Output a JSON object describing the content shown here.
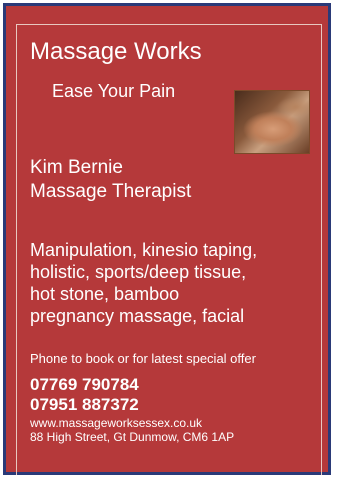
{
  "business": {
    "name": "Massage Works",
    "tagline": "Ease Your Pain"
  },
  "therapist": {
    "name": "Kim Bernie",
    "role": "Massage Therapist"
  },
  "services": {
    "lines": [
      "Manipulation, kinesio taping,",
      "holistic, sports/deep tissue,",
      "hot stone, bamboo",
      "pregnancy massage, facial"
    ]
  },
  "contact": {
    "phone_label": "Phone to book or for latest special offer",
    "phones": [
      "07769 790784",
      "07951 887372"
    ],
    "website": "www.massageworksessex.co.uk",
    "address": "88 High Street, Gt Dunmow, CM6 1AP"
  },
  "colors": {
    "background": "#b5393a",
    "border": "#2a3a78",
    "text": "#ffffff"
  },
  "image": {
    "icon": "massage-photo"
  }
}
